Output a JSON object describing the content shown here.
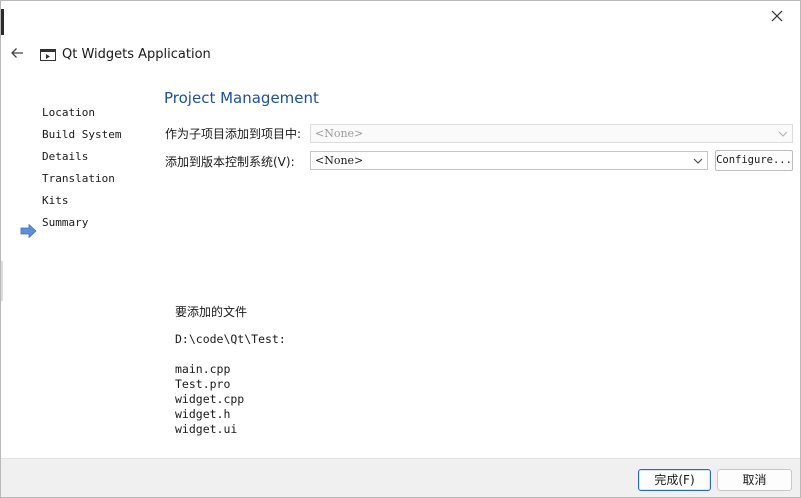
{
  "window": {
    "title": "Qt Widgets Application"
  },
  "sidebar": {
    "items": [
      {
        "label": "Location"
      },
      {
        "label": "Build System"
      },
      {
        "label": "Details"
      },
      {
        "label": "Translation"
      },
      {
        "label": "Kits"
      },
      {
        "label": "Summary",
        "current": true
      }
    ]
  },
  "page": {
    "title": "Project Management",
    "subproject_label": "作为子项目添加到项目中:",
    "subproject_value": "<None>",
    "vcs_label": "添加到版本控制系统(V):",
    "vcs_value": "<None>",
    "configure_label": "Configure..."
  },
  "files": {
    "title": "要添加的文件",
    "directory": "D:\\code\\Qt\\Test:",
    "list": [
      "main.cpp",
      "Test.pro",
      "widget.cpp",
      "widget.h",
      "widget.ui"
    ]
  },
  "footer": {
    "finish_label": "完成(F)",
    "cancel_label": "取消"
  },
  "colors": {
    "accent": "#1f4fa1",
    "arrow": "#5b8fd8",
    "footer_bg": "#f0f0f0"
  }
}
